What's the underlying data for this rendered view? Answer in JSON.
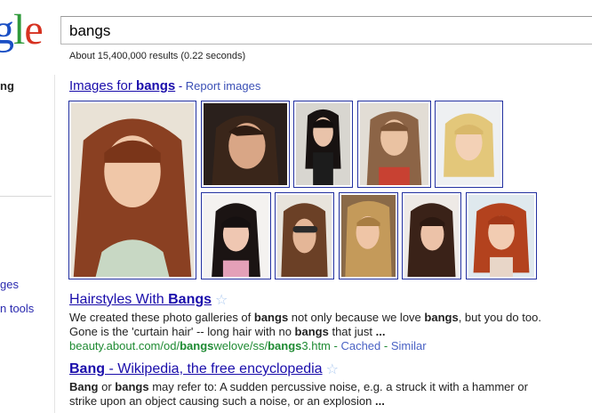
{
  "logo": {
    "part1": "g",
    "part2": "l",
    "part3": "e"
  },
  "search": {
    "query": "bangs"
  },
  "stats": "About 15,400,000 results (0.22 seconds)",
  "left_nav": {
    "selected": "ng",
    "link_1": "ges",
    "link_2": "n tools"
  },
  "images": {
    "link_prefix": "Images for ",
    "link_query": "bangs",
    "separator": " - ",
    "report": "Report images"
  },
  "results": [
    {
      "title_prefix": "Hairstyles With ",
      "title_bold": "Bangs",
      "snippet_1a": "We created these photo galleries of ",
      "snippet_1b": "bangs",
      "snippet_1c": " not only because we love ",
      "snippet_1d": "bangs",
      "snippet_1e": ", but you do too.",
      "snippet_2a": "Gone is the 'curtain hair' -- long hair with no ",
      "snippet_2b": "bangs",
      "snippet_2c": " that just ",
      "snippet_2d": "...",
      "cite_a": "beauty.about.com/od/",
      "cite_b": "bangs",
      "cite_c": "welove/ss/",
      "cite_d": "bangs",
      "cite_e": "3.htm",
      "cite_sep1": " - ",
      "cached": "Cached",
      "cite_sep2": " - ",
      "similar": "Similar"
    },
    {
      "title_bold": "Bang",
      "title_rest": " - Wikipedia, the free encyclopedia",
      "snippet_1a": "Bang",
      "snippet_1b": " or ",
      "snippet_1c": "bangs",
      "snippet_1d": " may refer to: A sudden percussive noise, e.g. a struck it with a hammer or",
      "snippet_2a": "strike upon an object causing such a noise, or an explosion ",
      "snippet_2b": "..."
    }
  ],
  "colors": {
    "link": "#1a0dab",
    "cite": "#1e8a32",
    "thumb_border": "#2230a0",
    "star": "#aac8f0"
  }
}
